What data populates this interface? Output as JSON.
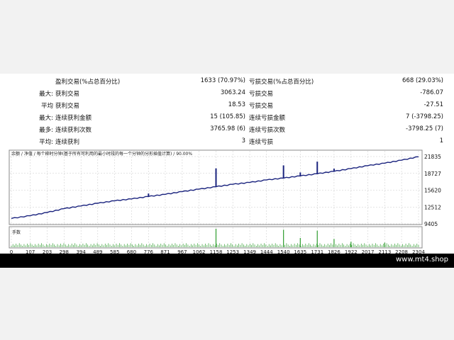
{
  "stats": [
    {
      "pre": "",
      "l1": "盈利交易(%占总百分比)",
      "v1": "1633 (70.97%)",
      "l2": "亏损交易(%占总百分比)",
      "v2": "668 (29.03%)"
    },
    {
      "pre": "最大:",
      "l1": "获利交易",
      "v1": "3063.24",
      "l2": "亏损交易",
      "v2": "-786.07"
    },
    {
      "pre": "平均",
      "l1": "获利交易",
      "v1": "18.53",
      "l2": "亏损交易",
      "v2": "-27.51"
    },
    {
      "pre": "最大:",
      "l1": "连续获利金额",
      "v1": "15 (105.85)",
      "l2": "连续亏损金额",
      "v2": "7 (-3798.25)"
    },
    {
      "pre": "最多:",
      "l1": "连续获利次数",
      "v1": "3765.98 (6)",
      "l2": "连续亏损次数",
      "v2": "-3798.25 (7)"
    },
    {
      "pre": "平均:",
      "l1": "连续获利",
      "v1": "3",
      "l2": "连续亏损",
      "v2": "1"
    }
  ],
  "chart_title": "余额 / 净值 / 每个柳时分钟(基于所有可利用的最小时段的每一个分钟的分形插值计算) / 90.00%",
  "volume_label": "手数",
  "footer_text": "www.mt4.shop",
  "colors": {
    "equity_line": "#1a237e",
    "volume": "#2e9d2e",
    "grid": "#c8c8c8"
  },
  "chart_data": {
    "type": "line",
    "x_ticks": [
      "0",
      "107",
      "203",
      "298",
      "394",
      "489",
      "585",
      "680",
      "776",
      "871",
      "967",
      "1062",
      "1158",
      "1253",
      "1349",
      "1444",
      "1540",
      "1635",
      "1731",
      "1826",
      "1922",
      "2017",
      "2113",
      "2208",
      "2304"
    ],
    "y_ticks": [
      "21835",
      "18727",
      "15620",
      "12512",
      "9405"
    ],
    "ylim": [
      9405,
      21835
    ],
    "xlim": [
      0,
      2304
    ],
    "series": [
      {
        "x": [
          0,
          107,
          203,
          298,
          394,
          489,
          585,
          680,
          776,
          871,
          967,
          1062,
          1158,
          1253,
          1349,
          1444,
          1540,
          1635,
          1731,
          1826,
          1922,
          2017,
          2113,
          2208,
          2304
        ],
        "y": [
          10400,
          10900,
          11500,
          12200,
          12700,
          13200,
          13650,
          14000,
          14450,
          14850,
          15350,
          15800,
          16250,
          16700,
          17050,
          17500,
          17850,
          18250,
          18650,
          19100,
          19600,
          20150,
          20600,
          21150,
          21800
        ],
        "spikes": [
          [
            776,
            15000
          ],
          [
            1158,
            19650
          ],
          [
            1540,
            20200
          ],
          [
            1635,
            18900
          ],
          [
            1731,
            20900
          ],
          [
            1826,
            19600
          ]
        ]
      }
    ],
    "volume": {
      "label": "手数",
      "spikes": [
        [
          1158,
          1.0
        ],
        [
          1540,
          0.95
        ],
        [
          1635,
          0.5
        ],
        [
          1731,
          0.9
        ],
        [
          1826,
          0.45
        ],
        [
          1922,
          0.3
        ],
        [
          2113,
          0.25
        ]
      ]
    }
  }
}
